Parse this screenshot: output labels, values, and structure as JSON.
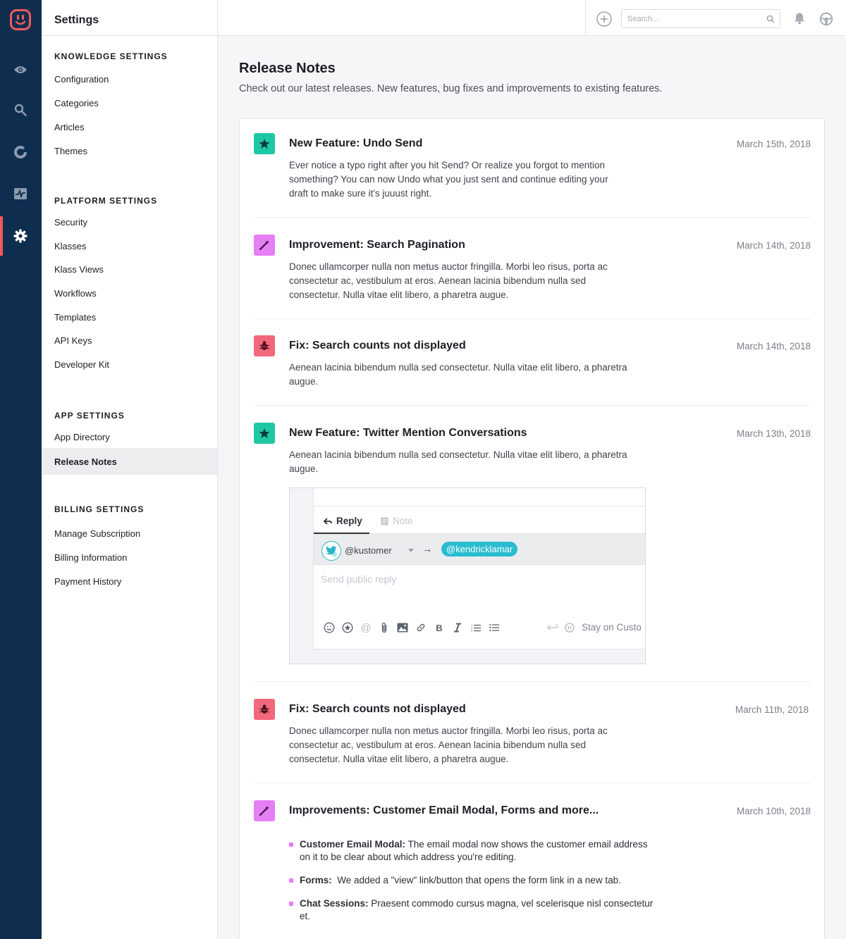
{
  "sidebar": {
    "header": "Settings",
    "sections": [
      {
        "title": "KNOWLEDGE SETTINGS",
        "items": [
          "Configuration",
          "Categories",
          "Articles",
          "Themes"
        ]
      },
      {
        "title": "PLATFORM SETTINGS",
        "items": [
          "Security",
          "Klasses",
          "Klass Views",
          "Workflows",
          "Templates",
          "API Keys",
          "Developer Kit"
        ]
      },
      {
        "title": "APP SETTINGS",
        "items": [
          "App Directory",
          "Release Notes"
        ]
      },
      {
        "title": "BILLING SETTINGS",
        "items": [
          "Manage Subscription",
          "Billing Information",
          "Payment History"
        ]
      }
    ],
    "active_item": "Release Notes"
  },
  "topbar": {
    "search_placeholder": "Search..."
  },
  "main": {
    "title": "Release Notes",
    "subtitle": "Check out our latest releases. New features, bug fixes and improvements to existing features."
  },
  "entries": [
    {
      "type": "feature",
      "icon": "star-icon",
      "title": "New Feature: Undo Send",
      "date": "March 15th, 2018",
      "body": "Ever notice a typo right after you hit Send? Or realize you forgot to mention something? You can now Undo what you just sent and continue editing your draft to make sure it's juuust right."
    },
    {
      "type": "improvement",
      "icon": "magic-wand-icon",
      "title": "Improvement: Search Pagination",
      "date": "March 14th, 2018",
      "body": "Donec ullamcorper nulla non metus auctor fringilla. Morbi leo risus, porta ac consectetur ac, vestibulum at eros. Aenean lacinia bibendum nulla sed consectetur. Nulla vitae elit libero, a pharetra augue."
    },
    {
      "type": "fix",
      "icon": "bug-icon",
      "title": "Fix: Search counts not displayed",
      "date": "March 14th, 2018",
      "body": "Aenean lacinia bibendum nulla sed consectetur. Nulla vitae elit libero, a pharetra augue."
    },
    {
      "type": "feature",
      "icon": "star-icon",
      "title": "New Feature: Twitter Mention Conversations",
      "date": "March 13th, 2018",
      "body": "Aenean lacinia bibendum nulla sed consectetur. Nulla vitae elit libero, a pharetra augue."
    },
    {
      "type": "fix",
      "icon": "bug-icon",
      "title": "Fix: Search counts not displayed",
      "date": "March 11th, 2018",
      "body": "Donec ullamcorper nulla non metus auctor fringilla. Morbi leo risus, porta ac consectetur ac, vestibulum at eros. Aenean lacinia bibendum nulla sed consectetur. Nulla vitae elit libero, a pharetra augue."
    },
    {
      "type": "improvement",
      "icon": "magic-wand-icon",
      "title": "Improvements: Customer Email Modal, Forms and more...",
      "date": "March 10th, 2018",
      "body": ""
    }
  ],
  "screenshot": {
    "tab_reply": "Reply",
    "tab_note": "Note",
    "from": "@kustomer",
    "to": "@kendricklamar",
    "placeholder": "Send public reply",
    "stay": "Stay on Custo"
  },
  "bullets": [
    {
      "label": "Customer Email Modal:",
      "text": " The email modal now shows the customer email address on it to be clear about which address you're editing."
    },
    {
      "label": "Forms:",
      "text": "  We added a \"view\" link/button that opens the form link in a new tab."
    },
    {
      "label": "Chat Sessions:",
      "text": " Praesent commodo cursus magna, vel scelerisque nisl consectetur et."
    }
  ],
  "colors": {
    "rail": "#0f2d4f",
    "accent_red": "#f05a5a",
    "feature": "#1ec8a5",
    "improvement": "#e67ef5",
    "fix": "#f2687b",
    "twitter_chip": "#2abcd0"
  }
}
